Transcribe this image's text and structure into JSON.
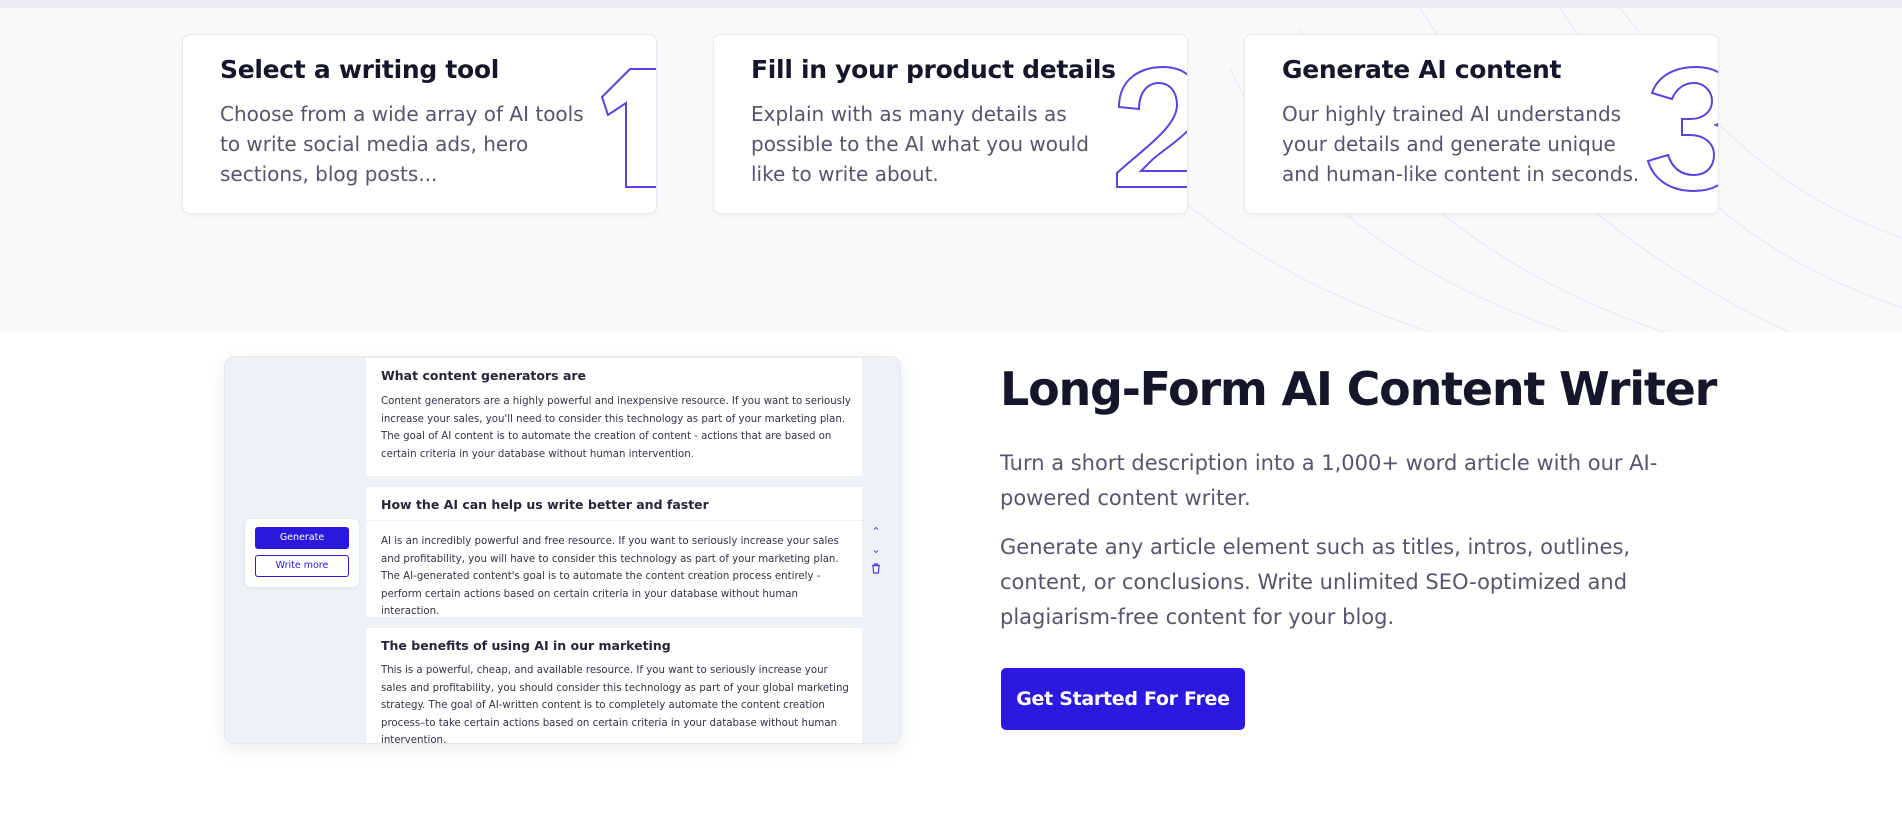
{
  "steps": [
    {
      "title": "Select a writing tool",
      "desc": "Choose from a wide array of AI tools to write social media ads, hero sections, blog posts...",
      "number": "1"
    },
    {
      "title": "Fill in your product details",
      "desc": "Explain with as many details as possible to the AI what you would like to write about.",
      "number": "2"
    },
    {
      "title": "Generate AI content",
      "desc": "Our highly trained AI understands your details and generate unique and human-like content in seconds.",
      "number": "3"
    }
  ],
  "colors": {
    "accent": "#2b19e0",
    "outline_number": "#5a43e0",
    "heading": "#16162a",
    "body_text": "#55566a"
  },
  "editor": {
    "generate_label": "Generate",
    "write_more_label": "Write more",
    "controls": [
      "chevron-up-icon",
      "chevron-down-icon",
      "trash-icon"
    ],
    "sections": [
      {
        "heading": "What content generators are",
        "body": "Content generators are a highly powerful and inexpensive resource. If you want to seriously increase your sales, you'll need to consider this technology as part of your marketing plan. The goal of AI content is to automate the creation of content - actions that are based on certain criteria in your database without human intervention."
      },
      {
        "heading": "How the AI can help us write better and faster",
        "body": "AI is an incredibly powerful and free resource. If you want to seriously increase your sales and profitability, you will have to consider this technology as part of your marketing plan. The AI-generated content's goal is to automate the content creation process entirely - perform certain actions based on certain criteria in your database without human interaction."
      },
      {
        "heading": "The benefits of using AI in our marketing",
        "body": "This is a powerful, cheap, and available resource. If you want to seriously increase your sales and profitability, you should consider this technology as part of your global marketing strategy. The goal of AI-written content is to completely automate the content creation process–to take certain actions based on certain criteria in your database without human intervention."
      }
    ]
  },
  "feature": {
    "title": "Long-Form AI Content Writer",
    "paragraph1": "Turn a short description into a 1,000+ word article with our AI-powered content writer.",
    "paragraph2": "Generate any article element such as titles, intros, outlines, content, or conclusions. Write unlimited SEO-optimized and plagiarism-free content for your blog.",
    "cta_label": "Get Started For Free"
  }
}
